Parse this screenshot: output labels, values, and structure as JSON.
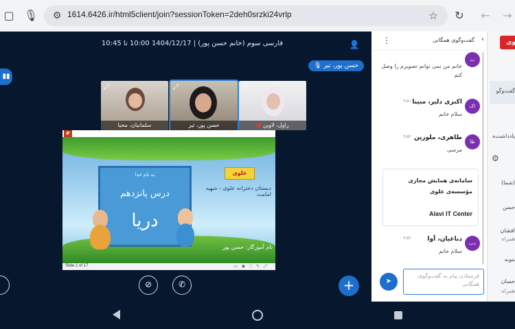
{
  "browser": {
    "url": "1614.6426.ir/html5client/join?sessionToken=2deh0srzki24vrlp"
  },
  "meeting": {
    "title": "فارسی سوم (خانم حسن پور) | 1404/12/17 10:00 تا 10:45",
    "speaker": "حسن پور، تیر"
  },
  "participants": [
    {
      "name": "سلمانیان، محیا"
    },
    {
      "name": "حسن پور، تیر"
    },
    {
      "name": "راول، لاوین"
    }
  ],
  "presentation": {
    "slide_counter": "Slide 1 of 17",
    "slide_subtitle": "به نام خدا",
    "lesson": "درس پانزدهم",
    "topic": "دریا",
    "school": "دبستان دخترانه علوی - شهید امامت",
    "logo": "علوی",
    "teacher": "نام آموزگار: حسن پور"
  },
  "chat": {
    "title": "گفت‌وگوی همگانی",
    "messages": [
      {
        "initials": "ب",
        "sender": "",
        "time": "",
        "text": "خانم من نمی توانم تصویرم را وصل کنم"
      },
      {
        "initials": "اک",
        "sender": "اکبری دلیر، مبینا",
        "time": "۹:۵۱",
        "text": "سلام خانم"
      },
      {
        "initials": "طا",
        "sender": "طاهری، ملورین",
        "time": "۹:۵۲",
        "text": "مرسی"
      },
      {
        "initials": "دب",
        "sender": "دباغیان، آوا",
        "time": "۹:۵۲",
        "text": "سلام خانم"
      }
    ],
    "system_card": {
      "line1": "سامانه‌ی همایش مجازی",
      "line2": "مؤسسه‌ی علوی",
      "line3": "Alavi IT Center"
    },
    "input_placeholder": "فرستادن پیام به گفت‌وگوی همگانی"
  },
  "strip": {
    "logo": "وی",
    "items": [
      "گفت‌وگو",
      "یادداشت‌ه",
      "(شما)",
      "حسن",
      "افشان",
      "همراه",
      "بنوبه",
      "حسان",
      "همراه"
    ]
  },
  "colors": {
    "accent": "#1e6ecb",
    "background": "#06172e"
  }
}
